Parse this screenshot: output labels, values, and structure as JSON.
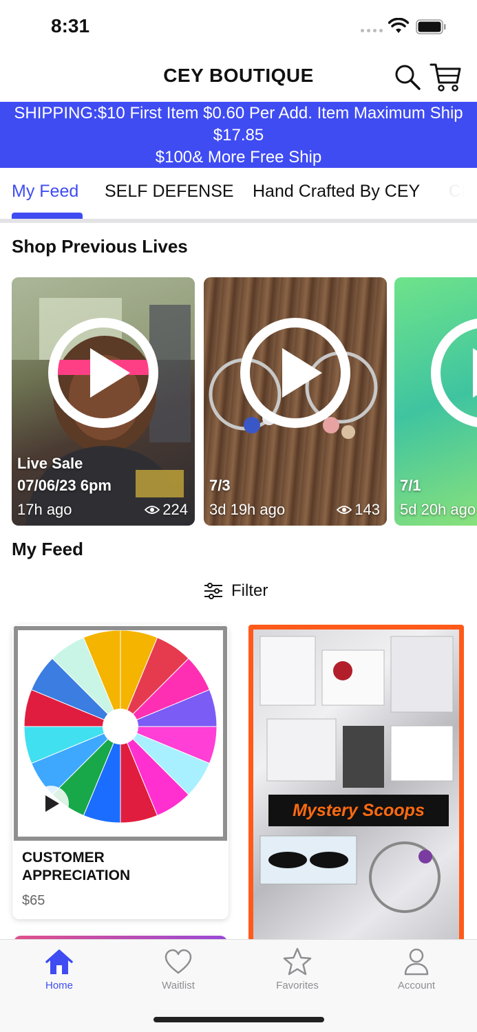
{
  "status_bar": {
    "time": "8:31"
  },
  "header": {
    "title": "CEY BOUTIQUE",
    "search_icon": "search-icon",
    "cart_icon": "cart-icon"
  },
  "banner": {
    "line1": "SHIPPING:$10 First Item $0.60  Per Add. Item Maximum Ship",
    "line2": "$17.85",
    "line3": "$100& More Free Ship",
    "background": "#3f4cf2"
  },
  "tabs": [
    {
      "label": "My Feed",
      "active": true
    },
    {
      "label": "SELF DEFENSE",
      "active": false
    },
    {
      "label": "Hand Crafted By CEY",
      "active": false
    },
    {
      "label": "Cl",
      "active": false
    }
  ],
  "previous_lives": {
    "title": "Shop Previous Lives",
    "cards": [
      {
        "caption_line1": "Live Sale",
        "caption_line2": "07/06/23 6pm",
        "ago": "17h ago",
        "views": "224"
      },
      {
        "caption_line1": "",
        "caption_line2": "7/3",
        "ago": "3d 19h ago",
        "views": "143"
      },
      {
        "caption_line1": "",
        "caption_line2": "7/1",
        "ago": "5d 20h ago",
        "views": ""
      }
    ]
  },
  "feed": {
    "title": "My Feed",
    "filter_label": "Filter",
    "products": [
      {
        "name": "CUSTOMER APPRECIATION",
        "price": "$65"
      },
      {
        "banner_text": "Mystery Scoops"
      }
    ]
  },
  "tab_bar": {
    "items": [
      {
        "label": "Home",
        "icon": "home-icon",
        "active": true
      },
      {
        "label": "Waitlist",
        "icon": "heart-icon",
        "active": false
      },
      {
        "label": "Favorites",
        "icon": "star-icon",
        "active": false
      },
      {
        "label": "Account",
        "icon": "person-icon",
        "active": false
      }
    ],
    "accent": "#3f4cf2"
  }
}
